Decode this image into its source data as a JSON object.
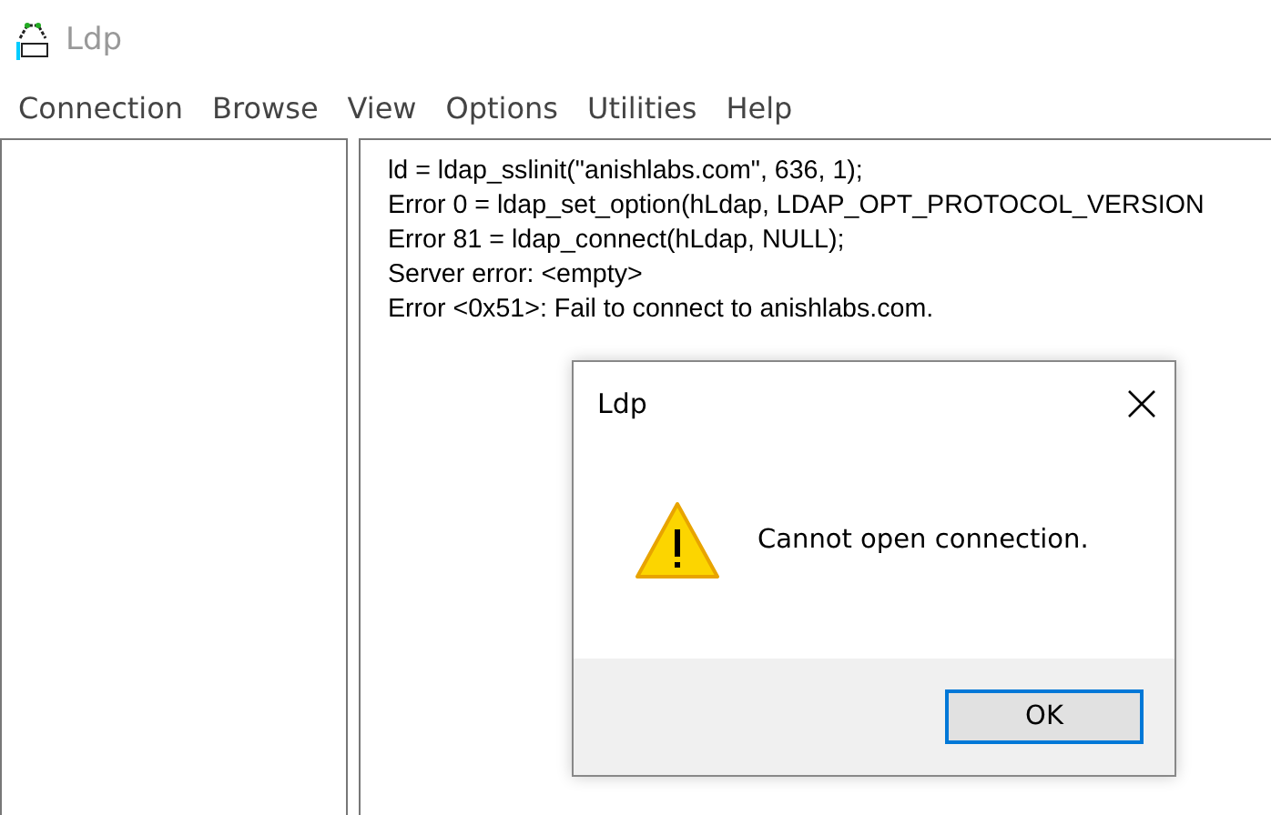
{
  "window": {
    "title": "Ldp",
    "active": false
  },
  "menu": [
    "Connection",
    "Browse",
    "View",
    "Options",
    "Utilities",
    "Help"
  ],
  "log": [
    "ld = ldap_sslinit(\"anishlabs.com\", 636, 1);",
    "Error 0 = ldap_set_option(hLdap, LDAP_OPT_PROTOCOL_VERSION",
    "Error 81 = ldap_connect(hLdap, NULL);",
    "Server error: <empty>",
    "Error <0x51>: Fail to connect to anishlabs.com."
  ],
  "dialog": {
    "title": "Ldp",
    "kind": "warning",
    "message": "Cannot open connection.",
    "buttons": [
      {
        "label": "OK",
        "default": true
      }
    ]
  }
}
